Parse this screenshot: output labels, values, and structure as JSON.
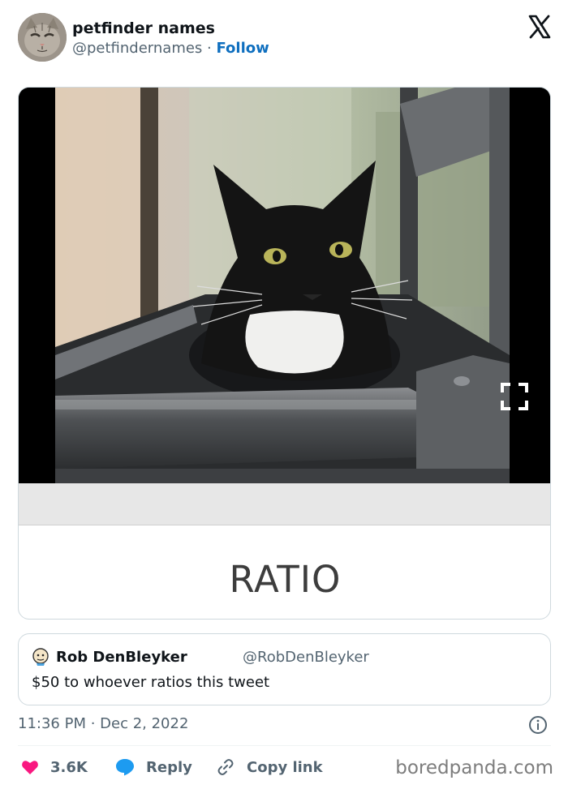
{
  "tweet": {
    "display_name": "petfinder names",
    "handle": "@petfindernames",
    "separator": " · ",
    "follow_label": "Follow",
    "media_caption": "RATIO",
    "timestamp": "11:36 PM · Dec 2, 2022"
  },
  "quoted": {
    "name": "Rob DenBleyker",
    "handle": "@RobDenBleyker",
    "text": "$50 to whoever ratios this tweet"
  },
  "actions": {
    "likes_count": "3.6K",
    "reply_label": "Reply",
    "copy_label": "Copy link"
  },
  "icons": [
    "x-logo-icon",
    "expand-icon",
    "info-icon",
    "heart-icon",
    "reply-bubble-icon",
    "link-icon"
  ],
  "colors": {
    "like": "#f91880",
    "reply": "#1d9bf0",
    "follow": "#0f6fbf",
    "muted": "#536471"
  },
  "watermark": "boredpanda.com"
}
